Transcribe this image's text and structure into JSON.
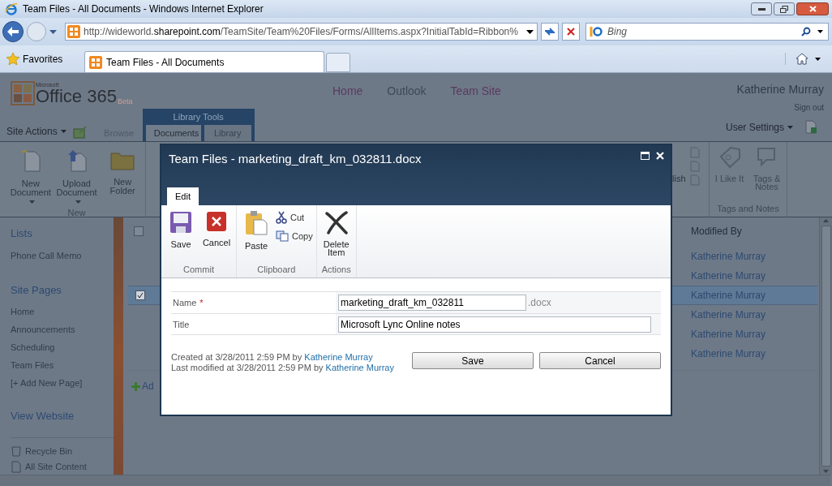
{
  "browser": {
    "title": "Team Files - All Documents - Windows Internet Explorer",
    "address_prefix": "http://wideworld.",
    "address_domain": "sharepoint.com",
    "address_rest": "/TeamSite/Team%20Files/Forms/AllItems.aspx?InitialTabId=Ribbon%",
    "search_placeholder": "Bing",
    "favorites": "Favorites",
    "tab": "Team Files - All Documents"
  },
  "site": {
    "logo_small": "Microsoft",
    "logo": "Office 365",
    "logo_badge": "Beta",
    "nav": [
      {
        "label": "Home",
        "color": "#5a3a5e"
      },
      {
        "label": "Outlook",
        "color": "#3e4856"
      },
      {
        "label": "Team Site",
        "color": "#5a3a5e"
      }
    ],
    "user": "Katherine Murray",
    "sign_out": "Sign out",
    "user_settings": "User Settings"
  },
  "ribbon": {
    "site_actions": "Site Actions",
    "context_label": "Library Tools",
    "tabs": [
      {
        "label": "Browse",
        "selected": false
      },
      {
        "label": "Documents",
        "selected": true
      },
      {
        "label": "Library",
        "selected": false
      }
    ],
    "new_group": {
      "label": "New",
      "buttons": [
        {
          "label": "New Document",
          "kind": "new-doc",
          "menu": true
        },
        {
          "label": "Upload Document",
          "kind": "upload",
          "menu": true
        },
        {
          "label": "New Folder",
          "kind": "folder",
          "menu": false
        }
      ]
    },
    "partial_button": "lish",
    "tags_group": {
      "label": "Tags and Notes",
      "buttons": [
        {
          "label": "I Like It",
          "kind": "like"
        },
        {
          "label": "Tags & Notes",
          "kind": "tags"
        }
      ]
    }
  },
  "left_nav": {
    "sections": [
      {
        "heading": "Lists",
        "items": [
          "Phone Call Memo"
        ]
      },
      {
        "heading": "Site Pages",
        "items": [
          "Home",
          "Announcements",
          "Scheduling",
          "Team Files",
          "[+ Add New Page]"
        ]
      }
    ],
    "view_website": "View Website",
    "footer": [
      "Recycle Bin",
      "All Site Content"
    ]
  },
  "list": {
    "column": "Modified By",
    "header_checked": false,
    "rows": [
      {
        "modified_by": "Katherine Murray",
        "selected": false
      },
      {
        "modified_by": "Katherine Murray",
        "selected": false
      },
      {
        "modified_by": "Katherine Murray",
        "selected": true
      },
      {
        "modified_by": "Katherine Murray",
        "selected": false
      },
      {
        "modified_by": "Katherine Murray",
        "selected": false
      },
      {
        "modified_by": "Katherine Murray",
        "selected": false
      }
    ],
    "add_link": "Ad"
  },
  "dialog": {
    "title": "Team Files - marketing_draft_km_032811.docx",
    "tab": "Edit",
    "groups": [
      {
        "label": "Commit",
        "buttons": [
          {
            "label": "Save",
            "kind": "save"
          },
          {
            "label": "Cancel",
            "kind": "cancel"
          }
        ]
      },
      {
        "label": "Clipboard",
        "buttons": [
          {
            "label": "Paste",
            "kind": "paste"
          },
          {
            "label": "Cut",
            "kind": "cut"
          },
          {
            "label": "Copy",
            "kind": "copy"
          }
        ]
      },
      {
        "label": "Actions",
        "buttons": [
          {
            "label": "Delete Item",
            "kind": "delete"
          }
        ]
      }
    ],
    "required_mark": "*",
    "fields": [
      {
        "label": "Name",
        "required": true,
        "value": "marketing_draft_km_032811",
        "suffix": ".docx"
      },
      {
        "label": "Title",
        "required": false,
        "value": "Microsoft Lync Online notes"
      }
    ],
    "created_prefix": "Created at 3/28/2011 2:59 PM by",
    "created_by": "Katherine Murray",
    "modified_prefix": "Last modified at 3/28/2011 2:59 PM by",
    "modified_by": "Katherine Murray",
    "buttons": [
      "Save",
      "Cancel"
    ]
  }
}
